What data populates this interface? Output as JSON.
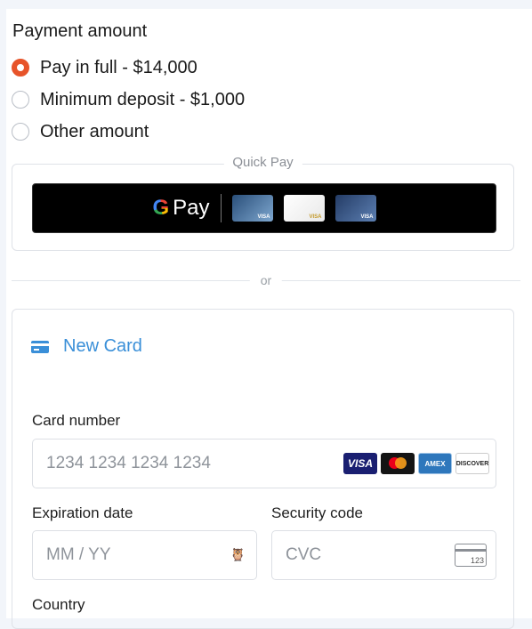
{
  "payment": {
    "title": "Payment amount",
    "options": [
      {
        "label": "Pay in full - $14,000",
        "selected": true
      },
      {
        "label": "Minimum deposit - $1,000",
        "selected": false
      },
      {
        "label": "Other amount",
        "selected": false
      }
    ]
  },
  "quick_pay": {
    "legend": "Quick Pay",
    "gpay_g": "G",
    "gpay_word": "Pay",
    "card_brand_mini": "VISA"
  },
  "divider": {
    "text": "or"
  },
  "new_card": {
    "label": "New Card",
    "card_number": {
      "label": "Card number",
      "placeholder": "1234 1234 1234 1234"
    },
    "brands": [
      "VISA",
      "AMEX",
      "DISCOVER"
    ],
    "expiration": {
      "label": "Expiration date",
      "placeholder": "MM / YY"
    },
    "security": {
      "label": "Security code",
      "placeholder": "CVC",
      "icon_text": "123"
    },
    "country": {
      "label": "Country"
    }
  },
  "colors": {
    "accent": "#e7542a",
    "link": "#3a8fd8"
  }
}
